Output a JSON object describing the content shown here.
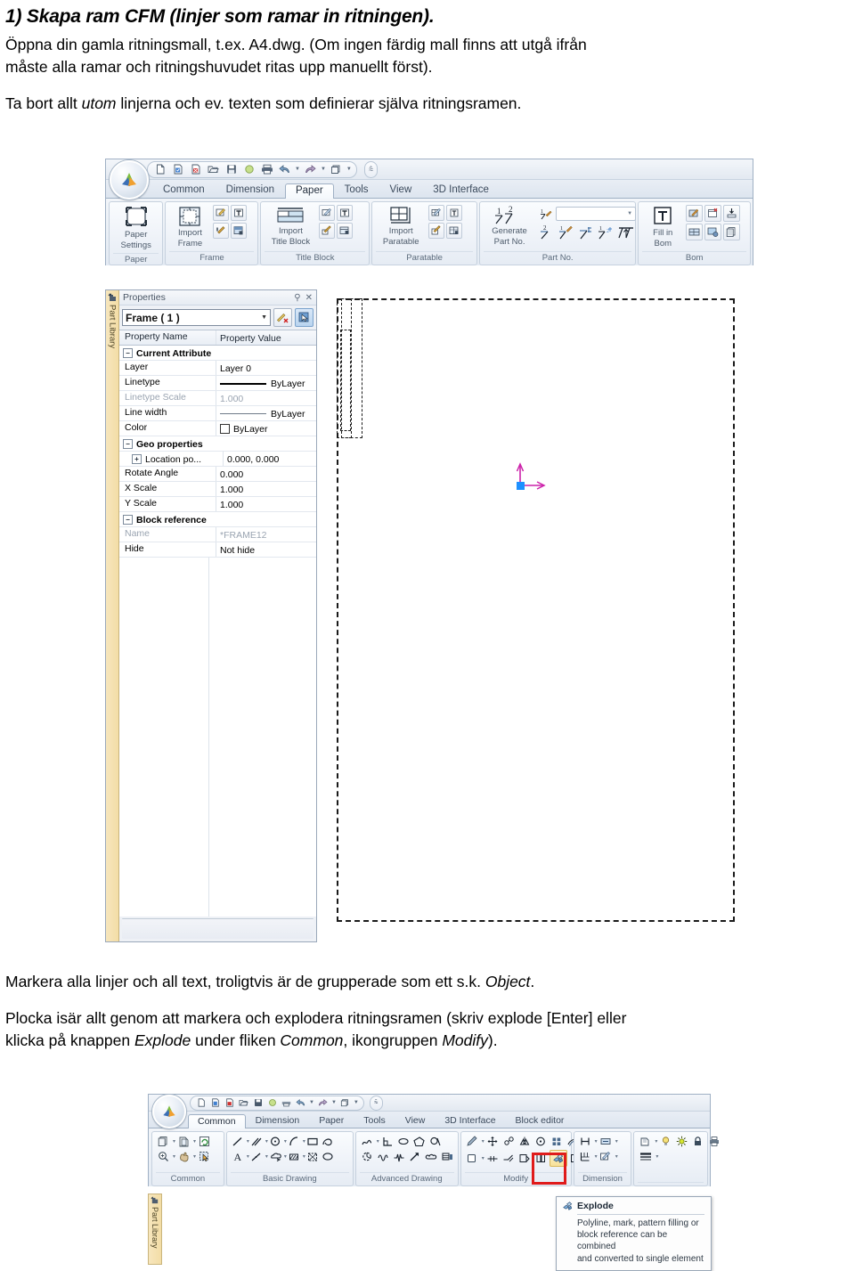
{
  "document": {
    "heading": "1) Skapa ram CFM (linjer som ramar in ritningen).",
    "paragraph1_a": "Öppna din gamla ritningsmall, t.ex. A4.dwg. (Om ingen färdig mall finns att utgå ifrån",
    "paragraph1_b": "måste alla ramar och ritningshuvudet ritas upp manuellt först).",
    "paragraph2_a": "Ta bort allt ",
    "paragraph2_it": "utom",
    "paragraph2_b": " linjerna och ev. texten som definierar själva ritningsramen.",
    "paragraph3_a": "Markera alla linjer och all text, troligtvis är de grupperade som ett s.k. ",
    "paragraph3_it": "Object",
    "paragraph3_b": ".",
    "paragraph4_a": "Plocka isär allt genom att markera och explodera ritningsramen (skriv explode [Enter] eller",
    "paragraph4_b1": "klicka på knappen ",
    "paragraph4_it1": "Explode",
    "paragraph4_b2": " under fliken ",
    "paragraph4_it2": "Common",
    "paragraph4_b3": ", ikongruppen ",
    "paragraph4_it3": "Modify",
    "paragraph4_b4": ")."
  },
  "screenshot_paper": {
    "quick_access": {
      "icons": [
        "new-document-icon",
        "open-template-icon",
        "close-document-icon",
        "open-folder-icon",
        "save-icon",
        "circle-icon",
        "print-icon",
        "undo-icon",
        "redo-icon",
        "window-icon",
        "customize-icon"
      ]
    },
    "tabs": [
      {
        "label": "Common",
        "active": false
      },
      {
        "label": "Dimension",
        "active": false
      },
      {
        "label": "Paper",
        "active": true
      },
      {
        "label": "Tools",
        "active": false
      },
      {
        "label": "View",
        "active": false
      },
      {
        "label": "3D Interface",
        "active": false
      }
    ],
    "groups": [
      {
        "name": "Paper",
        "label": "Paper",
        "big_button": {
          "line1": "Paper",
          "line2": "Settings",
          "icon": "paper-settings-icon"
        },
        "small_icons": []
      },
      {
        "name": "Frame",
        "label": "Frame",
        "big_button": {
          "line1": "Import",
          "line2": "Frame",
          "icon": "import-frame-icon"
        },
        "small_icons": [
          "edit-frame-icon",
          "frame-text-icon",
          "frame-attribute-icon",
          "save-frame-icon"
        ]
      },
      {
        "name": "Title Block",
        "label": "Title Block",
        "big_button": {
          "line1": "Import",
          "line2": "Title Block",
          "icon": "import-title-block-icon"
        },
        "small_icons": [
          "edit-title-block-icon",
          "title-block-text-icon",
          "title-block-attribute-icon",
          "save-title-block-icon"
        ]
      },
      {
        "name": "Paratable",
        "label": "Paratable",
        "big_button": {
          "line1": "Import",
          "line2": "Paratable",
          "icon": "import-paratable-icon"
        },
        "small_icons": [
          "edit-paratable-icon",
          "paratable-text-icon",
          "paratable-attribute-icon",
          "save-paratable-icon"
        ]
      },
      {
        "name": "Part No.",
        "label": "Part No.",
        "big_button": {
          "line1": "Generate",
          "line2": "Part No.",
          "icon": "generate-part-no-icon"
        },
        "combo_value": "",
        "small_icons": [
          "part-no-style-icon",
          "part-no-2-icon",
          "part-no-edit-icon",
          "part-no-arrange-icon",
          "part-no-sort-icon",
          "part-no-align-icon"
        ]
      },
      {
        "name": "Bom",
        "label": "Bom",
        "big_button": {
          "line1": "Fill in",
          "line2": "Bom",
          "icon": "fill-in-bom-icon"
        },
        "small_icons": [
          "bom-edit-icon",
          "bom-delete-icon",
          "bom-export-icon",
          "bom-table-icon",
          "bom-settings-icon",
          "bom-copy-icon"
        ]
      }
    ],
    "side_tab": {
      "label": "Part Library",
      "icon": "part-library-icon"
    },
    "properties_panel": {
      "title": "Properties",
      "pin_icon": "pin-icon",
      "close_icon": "close-icon",
      "selector_value": "Frame ( 1 )",
      "button_clear_icon": "clear-selection-icon",
      "button_pick_icon": "quick-select-icon",
      "columns": [
        "Property Name",
        "Property Value"
      ],
      "rows": [
        {
          "type": "group",
          "name": "Current Attribute"
        },
        {
          "type": "row",
          "name": "Layer",
          "value": "Layer 0",
          "dim": false,
          "value_kind": "text"
        },
        {
          "type": "row",
          "name": "Linetype",
          "value": "ByLayer",
          "dim": false,
          "value_kind": "linetype-solid"
        },
        {
          "type": "row",
          "name": "Linetype Scale",
          "value": "1.000",
          "dim": true,
          "value_kind": "text"
        },
        {
          "type": "row",
          "name": "Line width",
          "value": "ByLayer",
          "dim": false,
          "value_kind": "linetype-thin"
        },
        {
          "type": "row",
          "name": "Color",
          "value": "ByLayer",
          "dim": false,
          "value_kind": "swatch"
        },
        {
          "type": "group",
          "name": "Geo properties"
        },
        {
          "type": "row",
          "name": "Location po...",
          "value": "0.000, 0.000",
          "dim": false,
          "value_kind": "text",
          "sub_expander": true
        },
        {
          "type": "row",
          "name": "Rotate Angle",
          "value": "0.000",
          "dim": false,
          "value_kind": "text"
        },
        {
          "type": "row",
          "name": "X Scale",
          "value": "1.000",
          "dim": false,
          "value_kind": "text"
        },
        {
          "type": "row",
          "name": "Y Scale",
          "value": "1.000",
          "dim": false,
          "value_kind": "text"
        },
        {
          "type": "group",
          "name": "Block reference"
        },
        {
          "type": "row",
          "name": "Name",
          "value": "*FRAME12",
          "dim": true,
          "value_kind": "text"
        },
        {
          "type": "row",
          "name": "Hide",
          "value": "Not hide",
          "dim": false,
          "value_kind": "text"
        }
      ]
    },
    "canvas": {
      "ucs_origin_color": "#1e90ff",
      "ucs_axis_color": "#cc22aa",
      "frame_style": "dashed selection"
    }
  },
  "screenshot_common": {
    "tabs": [
      {
        "label": "Common",
        "active": true
      },
      {
        "label": "Dimension",
        "active": false
      },
      {
        "label": "Paper",
        "active": false
      },
      {
        "label": "Tools",
        "active": false
      },
      {
        "label": "View",
        "active": false
      },
      {
        "label": "3D Interface",
        "active": false
      },
      {
        "label": "Block editor",
        "active": false
      }
    ],
    "groups": [
      {
        "name": "Common",
        "label": "Common",
        "icons": [
          "copy-icon",
          "paste-icon",
          "refresh-icon",
          "zoom-icon",
          "pan-icon",
          "select-icon"
        ]
      },
      {
        "name": "Basic Drawing",
        "label": "Basic Drawing",
        "icons": [
          "line-icon",
          "parallel-line-icon",
          "circle-icon",
          "arc-icon",
          "rectangle-icon",
          "polyline-icon",
          "text-icon",
          "construction-line-icon",
          "revision-cloud-icon",
          "hatch-icon",
          "block-icon",
          "ellipse-icon"
        ]
      },
      {
        "name": "Advanced Drawing",
        "label": "Advanced Drawing",
        "icons": [
          "spline-icon",
          "angle-icon",
          "ellipse2-icon",
          "polygon-icon",
          "region-icon",
          "pie-icon",
          "wave-icon",
          "spring-icon",
          "arrow-icon",
          "cloud-icon",
          "table-icon"
        ]
      },
      {
        "name": "Modify",
        "label": "Modify",
        "icons": [
          "erase-icon",
          "move-icon",
          "rotate-icon",
          "mirror-icon",
          "scale-icon",
          "array-icon",
          "offset-icon",
          "trim-icon",
          "extend-icon",
          "fillet-icon",
          "chamfer-icon",
          "stretch-icon",
          "explode-icon",
          "break-icon"
        ],
        "highlighted_icon": "explode-icon"
      },
      {
        "name": "Dimension",
        "label": "Dimension",
        "icons": [
          "linear-dimension-icon",
          "dimension-style-icon",
          "baseline-dimension-icon",
          "dimension-edit-icon"
        ]
      },
      {
        "name": "Properties",
        "label": "",
        "icons": [
          "layer-icon",
          "bulb-icon",
          "sun-icon",
          "lock-icon",
          "print-layer-icon",
          "linewidth-icon",
          "linetype-line-icon"
        ]
      }
    ],
    "side_tab": {
      "label": "Part Library",
      "icon": "part-library-icon"
    },
    "highlight_color": "#e01b1b",
    "tooltip": {
      "title": "Explode",
      "icon": "explode-icon",
      "body_line1": "Polyline, mark, pattern filling or",
      "body_line2": "block reference can be combined",
      "body_line3": "and converted to single element"
    }
  }
}
